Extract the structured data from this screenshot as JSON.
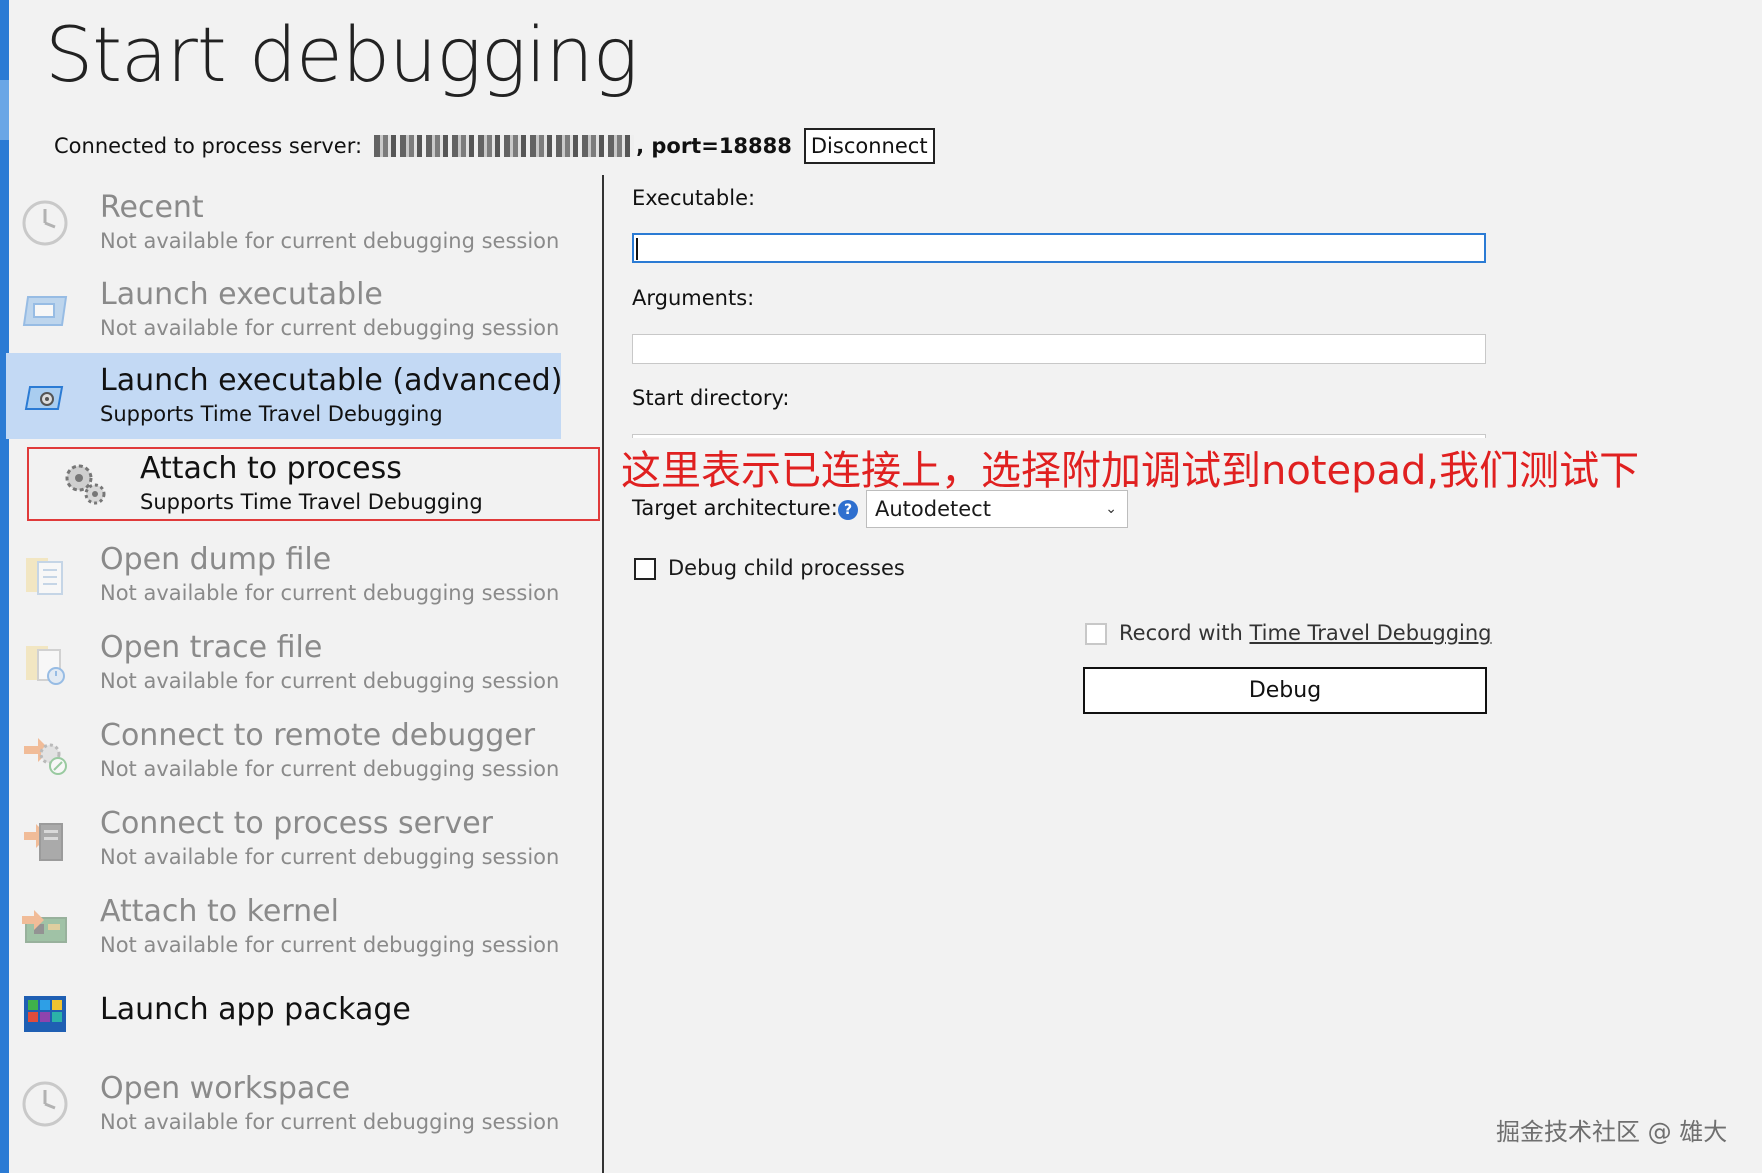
{
  "title": "Start debugging",
  "connection": {
    "label": "Connected to process server:",
    "port_text": ", port=18888",
    "disconnect_label": "Disconnect"
  },
  "sidebar": {
    "items": [
      {
        "title": "Recent",
        "subtitle": "Not available for current debugging session",
        "icon": "clock-icon",
        "enabled": false
      },
      {
        "title": "Launch executable",
        "subtitle": "Not available for current debugging session",
        "icon": "window-icon",
        "enabled": false
      },
      {
        "title": "Launch executable (advanced)",
        "subtitle": "Supports Time Travel Debugging",
        "icon": "window-gear-icon",
        "enabled": true,
        "selected": true
      },
      {
        "title": "Attach to process",
        "subtitle": "Supports Time Travel Debugging",
        "icon": "gears-icon",
        "enabled": true,
        "highlighted": true
      },
      {
        "title": "Open dump file",
        "subtitle": "Not available for current debugging session",
        "icon": "folder-document-icon",
        "enabled": false
      },
      {
        "title": "Open trace file",
        "subtitle": "Not available for current debugging session",
        "icon": "folder-trace-icon",
        "enabled": false
      },
      {
        "title": "Connect to remote debugger",
        "subtitle": "Not available for current debugging session",
        "icon": "remote-debugger-icon",
        "enabled": false
      },
      {
        "title": "Connect to process server",
        "subtitle": "Not available for current debugging session",
        "icon": "server-icon",
        "enabled": false
      },
      {
        "title": "Attach to kernel",
        "subtitle": "Not available for current debugging session",
        "icon": "circuit-board-icon",
        "enabled": false
      },
      {
        "title": "Launch app package",
        "subtitle": "",
        "icon": "app-package-icon",
        "enabled": true
      },
      {
        "title": "Open workspace",
        "subtitle": "Not available for current debugging session",
        "icon": "clock-icon",
        "enabled": false
      }
    ]
  },
  "form": {
    "executable_label": "Executable:",
    "executable_value": "",
    "arguments_label": "Arguments:",
    "arguments_value": "",
    "start_directory_label": "Start directory:",
    "start_directory_value": "",
    "target_architecture_label": "Target architecture:",
    "target_architecture_value": "Autodetect",
    "debug_child_label": "Debug child processes",
    "record_prefix": "Record with ",
    "record_link": "Time Travel Debugging",
    "debug_button": "Debug"
  },
  "annotation": "这里表示已连接上，选择附加调试到notepad,我们测试下",
  "watermark": "掘金技术社区 @ 雄大",
  "colors": {
    "accent": "#2b7bd4",
    "selected_bg": "#c3d9f4",
    "annotation_red": "#e02020",
    "highlight_border": "#e03a3a"
  }
}
